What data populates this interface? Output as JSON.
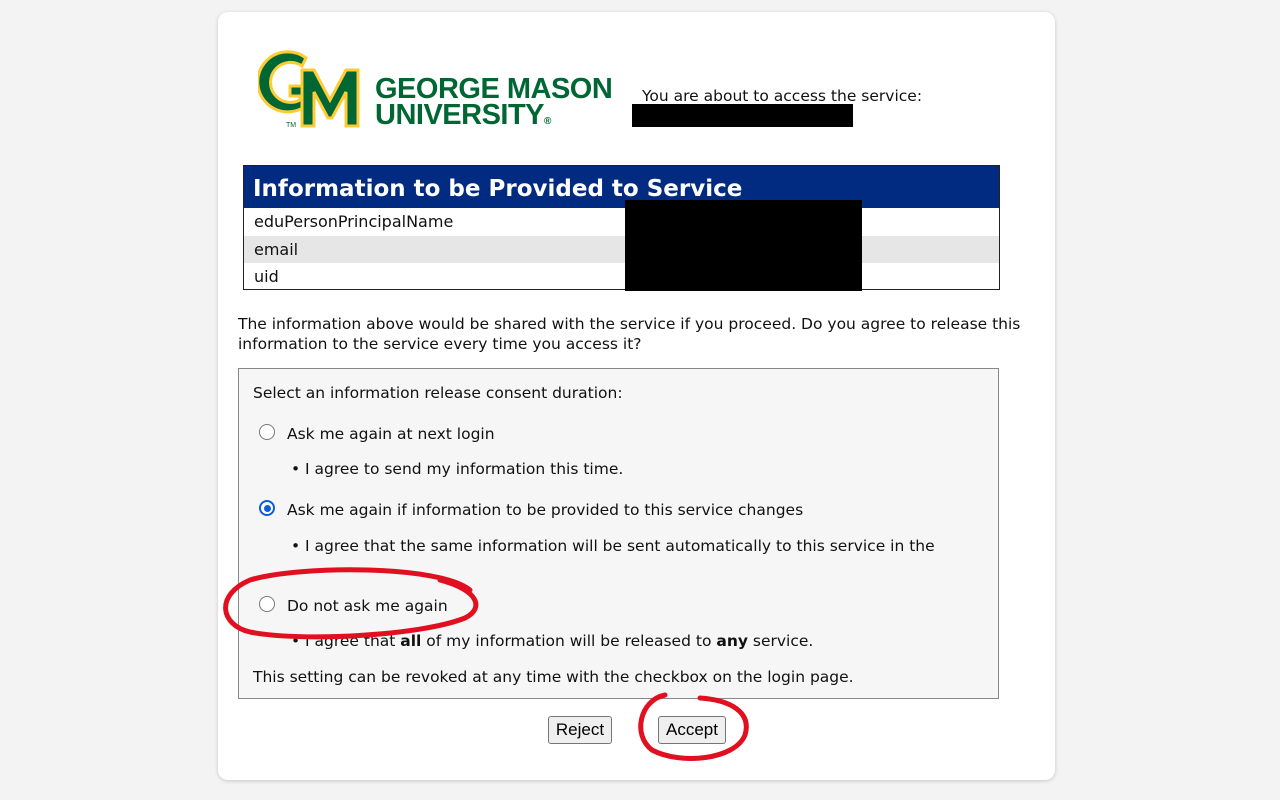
{
  "logo": {
    "monogram": "GM",
    "line1": "GEORGE MASON",
    "line2": "UNIVERSITY",
    "trademark": "TM",
    "registered": "®",
    "colors": {
      "green": "#006633",
      "gold": "#ffcc33"
    }
  },
  "service": {
    "access_text": "You are about to access the service:"
  },
  "info_table": {
    "title": "Information to be Provided to Service",
    "rows": [
      {
        "name": "eduPersonPrincipalName"
      },
      {
        "name": "email"
      },
      {
        "name": "uid"
      }
    ]
  },
  "prompt": "The information above would be shared with the service if you proceed. Do you agree to release this information to the service every time you access it?",
  "consent": {
    "heading": "Select an information release consent duration:",
    "options": [
      {
        "label": "Ask me again at next login",
        "selected": false,
        "bullet": "I agree to send my information this time."
      },
      {
        "label": "Ask me again if information to be provided to this service changes",
        "selected": true,
        "bullet": "I agree that the same information will be sent automatically to this service in the future."
      },
      {
        "label": "Do not ask me again",
        "selected": false,
        "bullet_pre": "I agree that ",
        "bullet_b1": "all",
        "bullet_mid": " of my information will be released to ",
        "bullet_b2": "any",
        "bullet_post": " service."
      }
    ],
    "footer": "This setting can be revoked at any time with the checkbox on the login page."
  },
  "buttons": {
    "reject": "Reject",
    "accept": "Accept"
  },
  "colors": {
    "header_bg": "#002b80",
    "radio_selected": "#0a5fd6",
    "annotation": "#e01020"
  }
}
